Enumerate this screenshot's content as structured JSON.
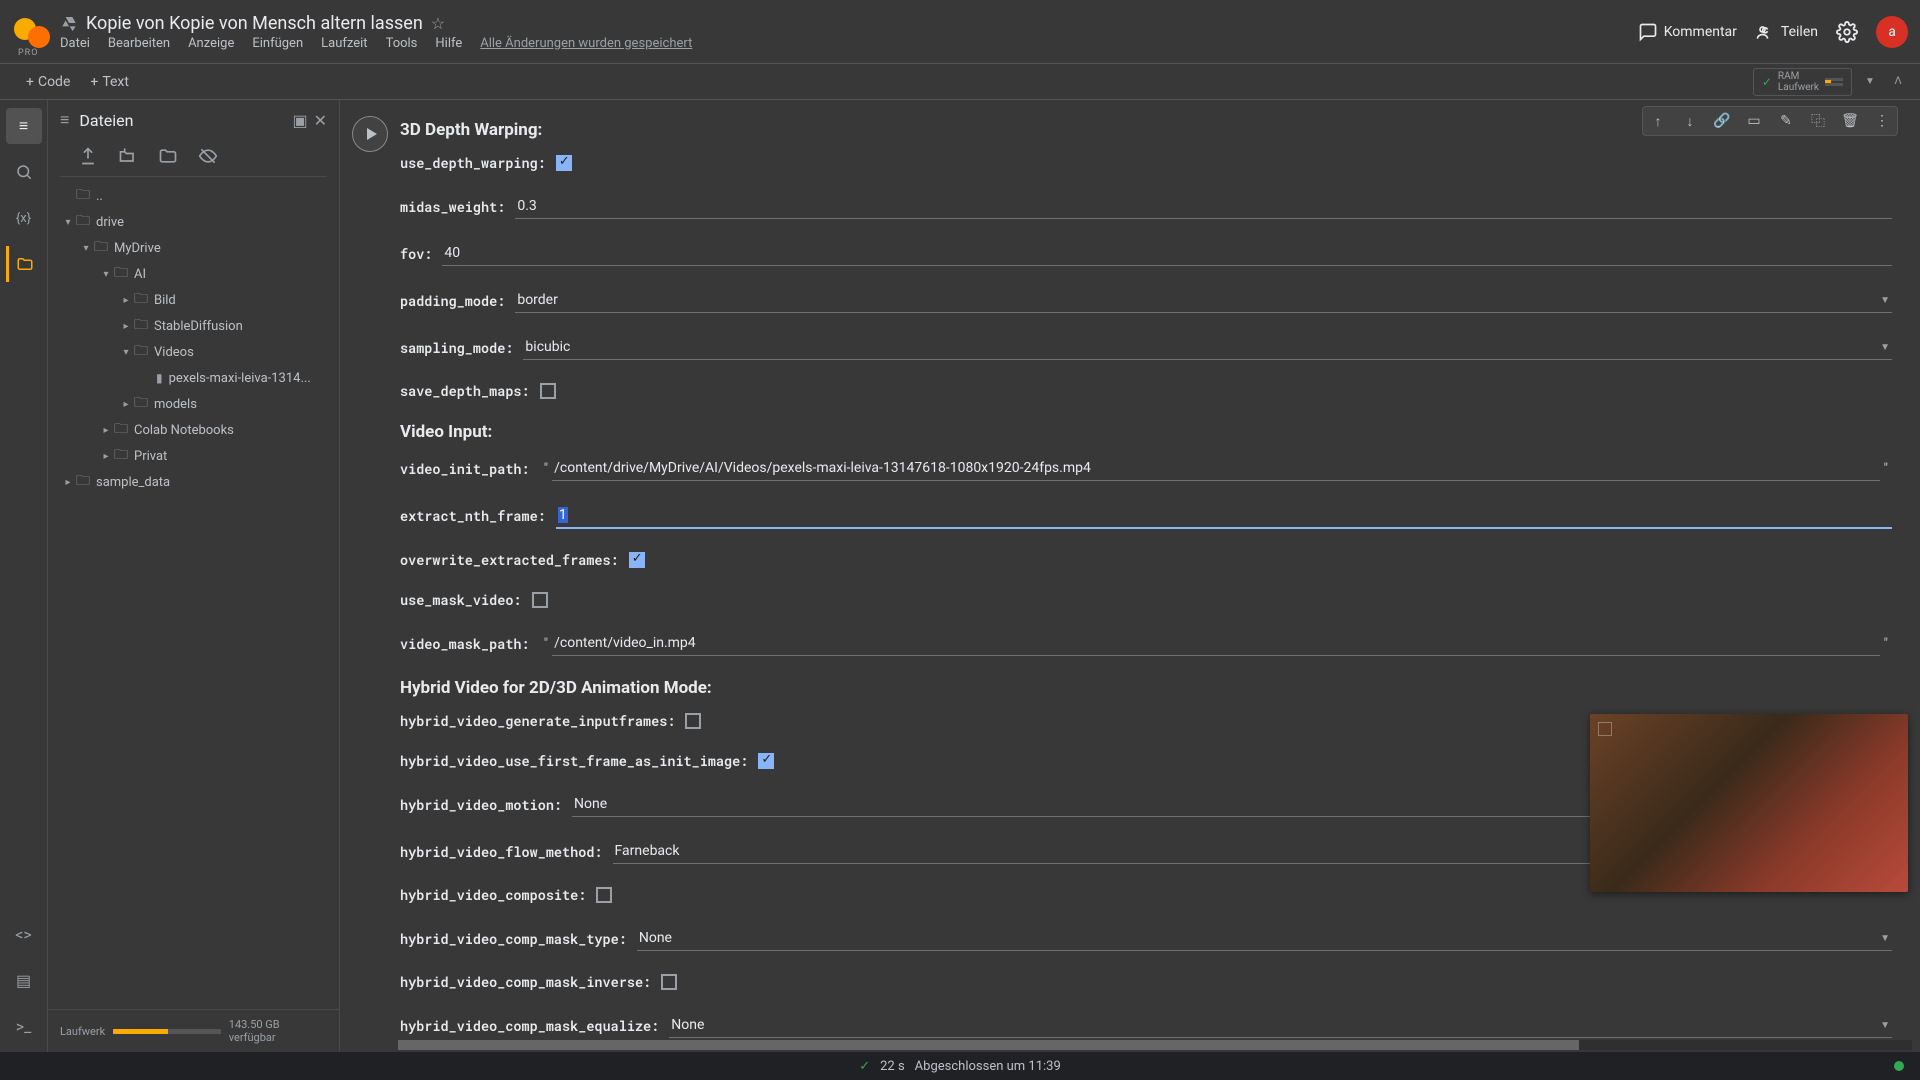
{
  "header": {
    "pro": "PRO",
    "title": "Kopie von Kopie von Mensch altern lassen",
    "menu": [
      "Datei",
      "Bearbeiten",
      "Anzeige",
      "Einfügen",
      "Laufzeit",
      "Tools",
      "Hilfe"
    ],
    "saved": "Alle Änderungen wurden gespeichert",
    "comment": "Kommentar",
    "share": "Teilen",
    "avatar": "a"
  },
  "toolbar": {
    "code": "Code",
    "text": "Text",
    "ram": "RAM",
    "runtime": "Laufwerk"
  },
  "files": {
    "title": "Dateien",
    "tree": {
      "dots": "..",
      "drive": "drive",
      "mydrive": "MyDrive",
      "ai": "AI",
      "bild": "Bild",
      "sd": "StableDiffusion",
      "videos": "Videos",
      "video_file": "pexels-maxi-leiva-1314...",
      "models": "models",
      "colab": "Colab Notebooks",
      "privat": "Privat",
      "sample": "sample_data"
    },
    "storage_label": "Laufwerk",
    "storage_free": "143.50 GB verfügbar"
  },
  "form": {
    "sec1": "3D Depth Warping:",
    "use_depth_warping": "use_depth_warping:",
    "midas_weight": "midas_weight:",
    "midas_weight_v": "0.3",
    "fov": "fov:",
    "fov_v": "40",
    "padding_mode": "padding_mode:",
    "padding_mode_v": "border",
    "sampling_mode": "sampling_mode:",
    "sampling_mode_v": "bicubic",
    "save_depth_maps": "save_depth_maps:",
    "sec2": "Video Input:",
    "video_init_path": "video_init_path:",
    "video_init_path_v": "/content/drive/MyDrive/AI/Videos/pexels-maxi-leiva-13147618-1080x1920-24fps.mp4",
    "extract_nth_frame": "extract_nth_frame:",
    "extract_nth_frame_v": "1",
    "overwrite_extracted_frames": "overwrite_extracted_frames:",
    "use_mask_video": "use_mask_video:",
    "video_mask_path": "video_mask_path:",
    "video_mask_path_v": "/content/video_in.mp4",
    "sec3": "Hybrid Video for 2D/3D Animation Mode:",
    "hv_gen": "hybrid_video_generate_inputframes:",
    "hv_first": "hybrid_video_use_first_frame_as_init_image:",
    "hv_motion": "hybrid_video_motion:",
    "hv_motion_v": "None",
    "hv_flow": "hybrid_video_flow_method:",
    "hv_flow_v": "Farneback",
    "hv_comp": "hybrid_video_composite:",
    "hv_mask": "hybrid_video_comp_mask_type:",
    "hv_mask_v": "None",
    "hv_inv": "hybrid_video_comp_mask_inverse:",
    "hv_eq": "hybrid_video_comp_mask_equalize:",
    "hv_eq_v": "None"
  },
  "status": {
    "time": "22 s",
    "done": "Abgeschlossen um 11:39"
  }
}
